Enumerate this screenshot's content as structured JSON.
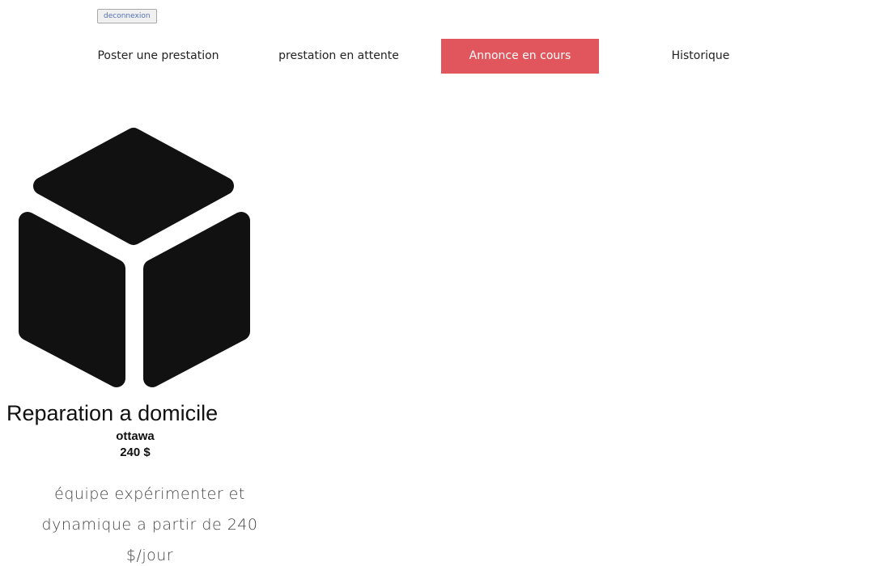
{
  "header": {
    "logout_label": "deconnexion"
  },
  "nav": {
    "items": [
      {
        "label": "Poster une prestation",
        "active": false
      },
      {
        "label": "prestation en attente",
        "active": false
      },
      {
        "label": "Annonce en cours",
        "active": true
      },
      {
        "label": "Historique",
        "active": false
      }
    ],
    "active_color": "#e0565c"
  },
  "listing": {
    "icon": "cube-icon",
    "title": "Reparation a domicile",
    "city": "ottawa",
    "price": "240 $",
    "description": "équipe expérimenter et dynamique a partir de 240 $/jour"
  }
}
